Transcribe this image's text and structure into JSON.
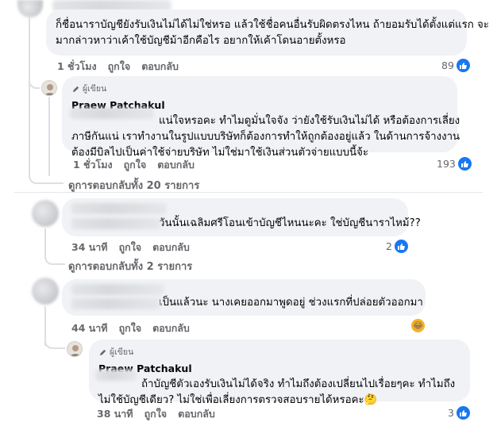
{
  "comments": [
    {
      "text_lines": [
        "ก็ชื่อนาราบัญชียังรับเงินไม่ได้ไม่ใช่หรอ แล้วใช้ชื่อคนอื่นรับผิดตรงไหน ถ้ายอมรับได้ตั้งแต่แรก จะ",
        "มากล่าวหาว่าเค้าใช้บัญชีม้าอีกคือไร อยากให้เค้าโดนอายตั้งหรอ"
      ],
      "time": "1 ชั่วโมง",
      "like_label": "ถูกใจ",
      "reply_label": "ตอบกลับ",
      "reaction_count": "89"
    },
    {
      "badge": "ผู้เขียน",
      "author": "Praew Patchakul",
      "text_lines": [
        "แน่ใจหรอคะ ทำไมดูมั่นใจจัง ว่ายังใช้รับเงินไม่ได้ หรือต้องการเลี่ยง",
        "ภาษีกันแน่ เราทำงานในรูปแบบบริษัทก็ต้องการทำให้ถูกต้องอยู่แล้ว ในด้านการจ้างงาน",
        "ต้องมีบิลไปเป็นค่าใช้จ่ายบริษัท ไม่ใช่มาใช้เงินส่วนตัวจ่ายแบบนี้จ้ะ"
      ],
      "time": "1 ชั่วโมง",
      "like_label": "ถูกใจ",
      "reply_label": "ตอบกลับ",
      "reaction_count": "193"
    },
    {
      "text_lines": [
        "วันนั้นเฉลิมศรีโอนเข้าบัญชีไหนนะคะ ใช่บัญชีนาราไหม้??"
      ],
      "time": "34 นาที",
      "like_label": "ถูกใจ",
      "reply_label": "ตอบกลับ",
      "reaction_count": "2"
    },
    {
      "text_lines": [
        "เป็นแล้วนะ นางเคยออกมาพูดอยู่ ช่วงแรกที่ปล่อยตัวออกมา"
      ],
      "time": "44 นาที",
      "like_label": "ถูกใจ",
      "reply_label": "ตอบกลับ",
      "reaction_emoji": "😂"
    },
    {
      "badge": "ผู้เขียน",
      "author": "Praew Patchakul",
      "text_lines": [
        "ถ้าบัญชีตัวเองรับเงินไม่ได้จริง ทำไมถึงต้องเปลี่ยนไปเรื่อยๆคะ ทำไมถึง",
        "ไม่ใช้บัญชีเดียว? ไม่ใช่เพื่อเลี่ยงการตรวจสอบรายได้หรอคะ🤔"
      ],
      "time": "38 นาที",
      "like_label": "ถูกใจ",
      "reply_label": "ตอบกลับ",
      "reaction_count": "3"
    }
  ],
  "view_replies": [
    "ดูการตอบกลับทั้ง 20 รายการ",
    "ดูการตอบกลับทั้ง 2 รายการ"
  ],
  "colors": {
    "bubble": "#f0f2f5",
    "meta_text": "#65676b",
    "like_blue": "#1877f2"
  }
}
